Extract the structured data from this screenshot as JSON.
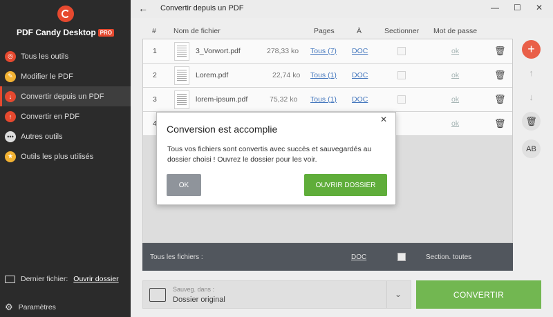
{
  "app": {
    "brand": "PDF Candy Desktop",
    "pro_badge": "PRO"
  },
  "sidebar": {
    "items": [
      {
        "label": "Tous les outils",
        "icon": "candy-icon",
        "color": "#e6492f"
      },
      {
        "label": "Modifier le PDF",
        "icon": "edit-icon",
        "color": "#f2b233"
      },
      {
        "label": "Convertir depuis un PDF",
        "icon": "convert-from-icon",
        "color": "#e6492f",
        "active": true
      },
      {
        "label": "Convertir en PDF",
        "icon": "convert-to-icon",
        "color": "#e6492f"
      },
      {
        "label": "Autres outils",
        "icon": "dots-icon",
        "color": "#dddddd"
      },
      {
        "label": "Outils les plus utilisés",
        "icon": "star-icon",
        "color": "#f2b233"
      }
    ],
    "last_file_label": "Dernier fichier:",
    "last_file_link": "Ouvrir dossier",
    "settings_label": "Paramètres"
  },
  "topbar": {
    "title": "Convertir depuis un PDF"
  },
  "table": {
    "headers": {
      "num": "#",
      "name": "Nom de fichier",
      "pages": "Pages",
      "to": "À",
      "select": "Sectionner",
      "password": "Mot de passe"
    },
    "rows": [
      {
        "num": "1",
        "name": "3_Vorwort.pdf",
        "size": "278,33 ko",
        "pages": "Tous (7)",
        "format": "DOC",
        "password": "ok"
      },
      {
        "num": "2",
        "name": "Lorem.pdf",
        "size": "22,74 ko",
        "pages": "Tous (1)",
        "format": "DOC",
        "password": "ok"
      },
      {
        "num": "3",
        "name": "lorem-ipsum.pdf",
        "size": "75,32 ko",
        "pages": "Tous (1)",
        "format": "DOC",
        "password": "ok"
      },
      {
        "num": "4",
        "name": "",
        "size": "",
        "pages": "",
        "format": "",
        "password": "ok"
      }
    ],
    "footer": {
      "all_files": "Tous les fichiers :",
      "format": "DOC",
      "select_all": "Section. toutes"
    }
  },
  "bottom": {
    "save_label": "Sauveg. dans :",
    "save_value": "Dossier original",
    "convert": "CONVERTIR"
  },
  "dialog": {
    "title": "Conversion est accomplie",
    "message": "Tous vos fichiers sont convertis avec succès et sauvegardés au dossier choisi ! Ouvrez le dossier pour les voir.",
    "ok": "OK",
    "open_folder": "OUVRIR DOSSIER"
  },
  "colors": {
    "accent": "#e6492f",
    "green": "#5fad3a",
    "sidebar_bg": "#2b2b2b"
  }
}
